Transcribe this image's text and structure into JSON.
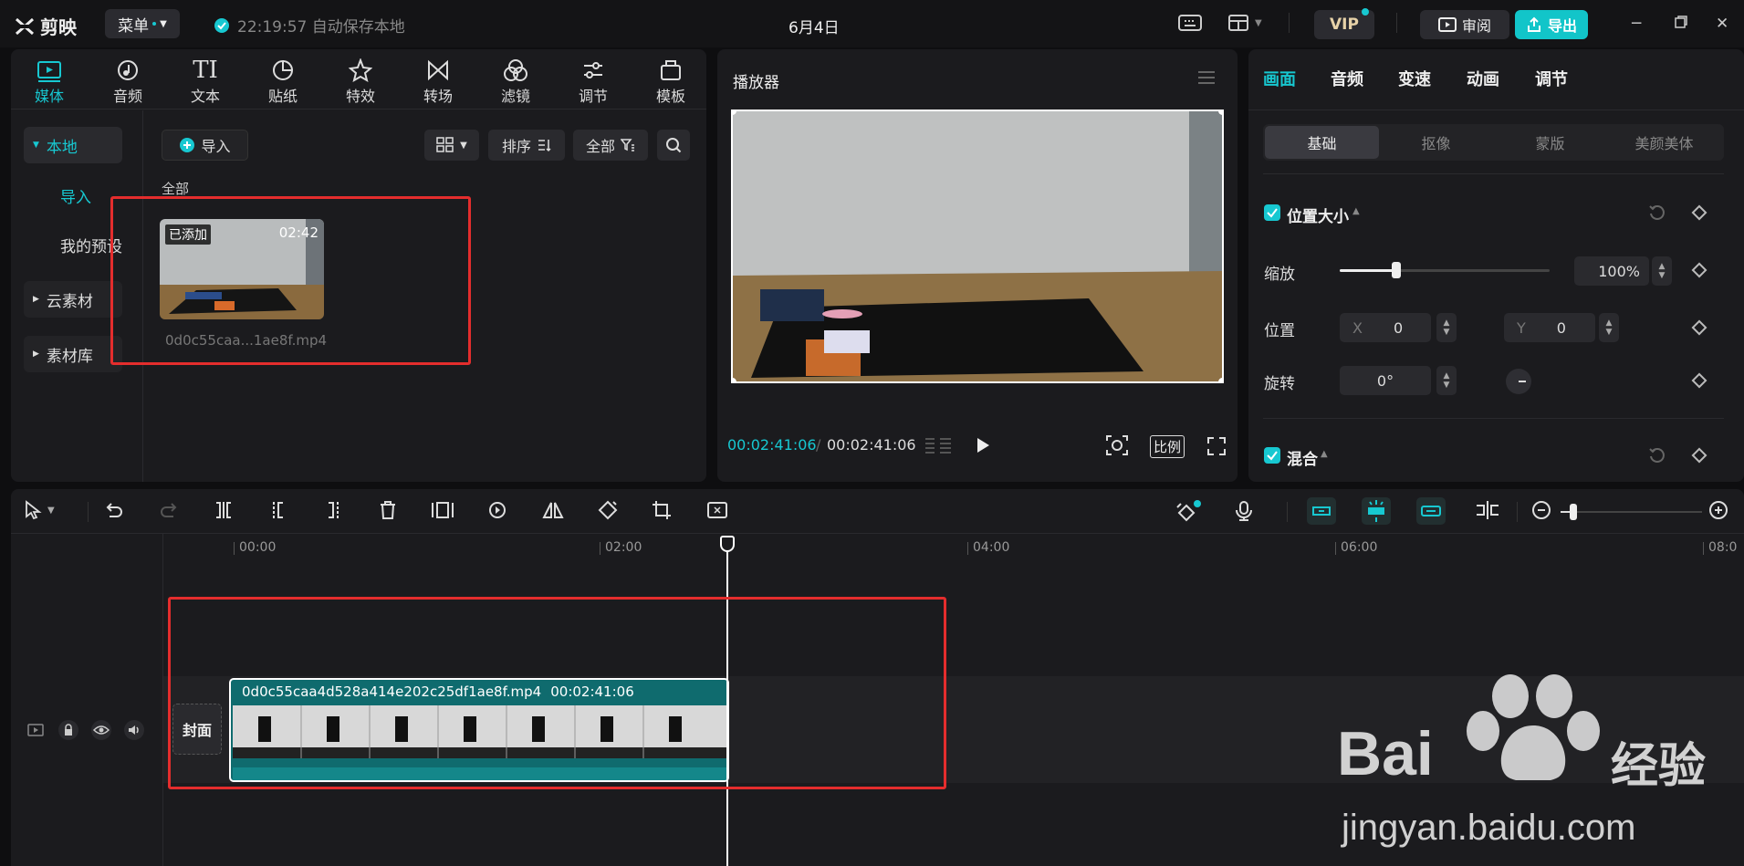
{
  "app": {
    "name": "剪映",
    "menu_label": "菜单",
    "autosave": "22:19:57 自动保存本地",
    "doc_title": "6月4日",
    "vip": "VIP",
    "review": "审阅",
    "export": "导出"
  },
  "media_tabs": [
    {
      "label": "媒体",
      "icon": "media-icon",
      "active": true
    },
    {
      "label": "音频",
      "icon": "audio-icon"
    },
    {
      "label": "文本",
      "icon": "text-icon"
    },
    {
      "label": "贴纸",
      "icon": "sticker-icon"
    },
    {
      "label": "特效",
      "icon": "effects-icon"
    },
    {
      "label": "转场",
      "icon": "transition-icon"
    },
    {
      "label": "滤镜",
      "icon": "filter-icon"
    },
    {
      "label": "调节",
      "icon": "adjust-icon"
    },
    {
      "label": "模板",
      "icon": "template-icon"
    }
  ],
  "sidebar": {
    "local": "本地",
    "import": "导入",
    "presets": "我的预设",
    "cloud": "云素材",
    "library": "素材库"
  },
  "media_toolbar": {
    "import": "导入",
    "sort": "排序",
    "filter": "全部"
  },
  "media": {
    "section": "全部",
    "item": {
      "badge": "已添加",
      "duration": "02:42",
      "filename": "0d0c55caa...1ae8f.mp4"
    }
  },
  "player": {
    "title": "播放器",
    "current_time": "00:02:41:06",
    "total_time": "00:02:41:06",
    "ratio": "比例"
  },
  "inspector": {
    "tabs": [
      "画面",
      "音频",
      "变速",
      "动画",
      "调节"
    ],
    "subtabs": [
      "基础",
      "抠像",
      "蒙版",
      "美颜美体"
    ],
    "position_size": "位置大小",
    "scale_label": "缩放",
    "scale_value": "100%",
    "scale_fraction": 0.27,
    "position_label": "位置",
    "x_label": "X",
    "x_value": "0",
    "y_label": "Y",
    "y_value": "0",
    "rotate_label": "旋转",
    "rotate_value": "0°",
    "blend": "混合"
  },
  "timeline": {
    "ruler": [
      "00:00",
      "02:00",
      "04:00",
      "06:00",
      "08:0"
    ],
    "cover": "封面",
    "clip_name": "0d0c55caa4d528a414e202c25df1ae8f.mp4",
    "clip_duration": "00:02:41:06"
  },
  "watermark": {
    "text_main": "Bai",
    "text_cn": "经验",
    "url": "jingyan.baidu.com"
  },
  "colors": {
    "accent": "#17c8d1",
    "highlight": "#e42d2d",
    "clip": "#0f6b6e"
  }
}
